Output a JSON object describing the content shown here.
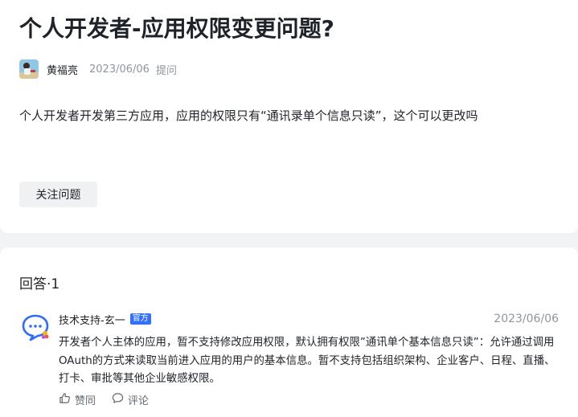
{
  "question": {
    "title": "个人开发者-应用权限变更问题?",
    "author": "黄福亮",
    "date": "2023/06/06",
    "action": "提问",
    "body": "个人开发者开发第三方应用，应用的权限只有“通讯录单个信息只读”，这个可以更改吗",
    "follow_label": "关注问题"
  },
  "answers": {
    "header": "回答·1",
    "items": [
      {
        "author": "技术支持-玄一",
        "badge": "官方",
        "date": "2023/06/06",
        "body": "开发者个人主体的应用，暂不支持修改应用权限，默认拥有权限”通讯单个基本信息只读”：允许通过调用OAuth的方式来读取当前进入应用的用户的基本信息。暂不支持包括组织架构、企业客户、日程、直播、打卡、审批等其他企业敏感权限。",
        "like_label": "赞同",
        "comment_label": "评论"
      }
    ]
  },
  "colors": {
    "accent": "#3370ff",
    "muted": "#8f959e",
    "background": "#f2f3f5"
  },
  "icons": [
    "avatar",
    "dingtalk-logo-icon",
    "thumbs-up-icon",
    "comment-icon"
  ]
}
